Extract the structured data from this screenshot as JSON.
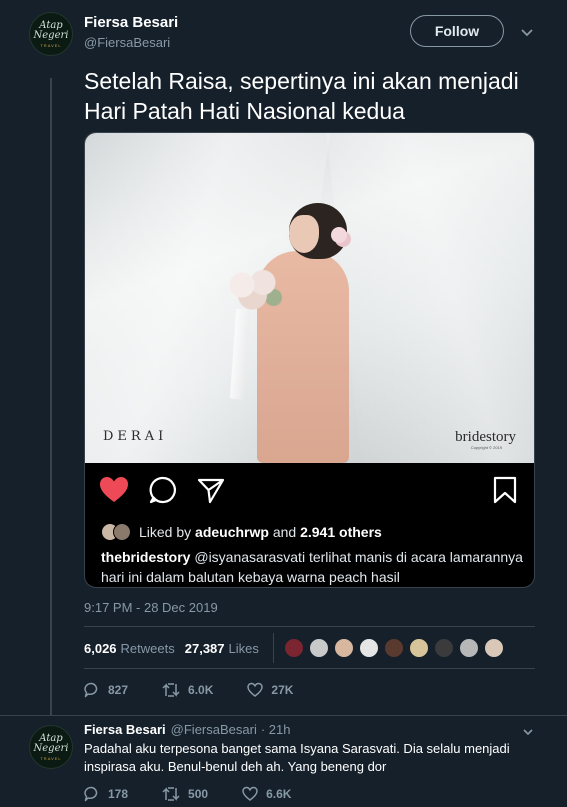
{
  "tweet": {
    "author": {
      "name": "Fiersa Besari",
      "handle": "@FiersaBesari",
      "avatar_text": [
        "Atap",
        "Negeri",
        "TRAVEL"
      ]
    },
    "follow_label": "Follow",
    "text": "Setelah Raisa, sepertinya ini akan menjadi Hari Patah Hati Nasional kedua",
    "embed": {
      "photo_brand_left": "DERAI",
      "photo_brand_right": "bridestory",
      "photo_copyright": "Copyright © 2019",
      "liked_by_prefix": "Liked by",
      "liked_by_user": "adeuchrwp",
      "liked_by_and": "and",
      "liked_by_others": "2.941 others",
      "caption_user": "thebridestory",
      "caption_text": "@isyanasarasvati terlihat manis di acara lamarannya hari ini dalam balutan kebaya warna peach hasil",
      "heart_color": "#ed4956"
    },
    "timestamp": "9:17 PM - 28 Dec 2019",
    "stats": {
      "retweets_value": "6,026",
      "retweets_label": "Retweets",
      "likes_value": "27,387",
      "likes_label": "Likes"
    },
    "liker_colors": [
      "#7a2530",
      "#c9c9c9",
      "#d8b7a0",
      "#e5e5e5",
      "#5a3a2e",
      "#d8c49a",
      "#3b3b3b",
      "#b7b7b7",
      "#d9c8b8"
    ],
    "actions": {
      "replies": "827",
      "retweets": "6.0K",
      "likes": "27K"
    }
  },
  "reply": {
    "author": {
      "name": "Fiersa Besari",
      "handle": "@FiersaBesari",
      "time": "· 21h"
    },
    "text": "Padahal aku terpesona banget sama Isyana Sarasvati. Dia selalu menjadi inspirasa aku. Benul-benul deh ah. Yang beneng dor",
    "actions": {
      "replies": "178",
      "retweets": "500",
      "likes": "6.6K"
    }
  }
}
